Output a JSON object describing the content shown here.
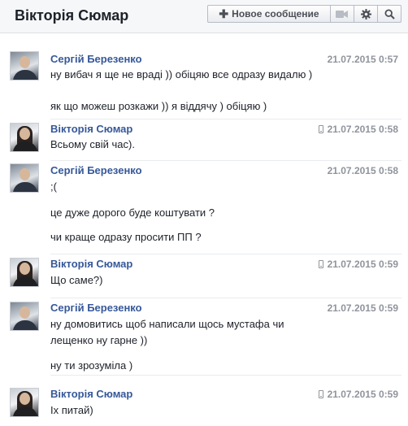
{
  "header": {
    "title": "Вікторія Сюмар",
    "new_message_label": "Новое сообщение",
    "icons": [
      "video-call-icon",
      "gear-icon",
      "search-icon"
    ]
  },
  "messages": [
    {
      "sender": "Сергій Березенко",
      "time": "21.07.2015 0:57",
      "mobile": false,
      "lines": [
        "ну вибач я ще не враді )) обіцяю все одразу видалю )",
        "як що можеш розкажи )) я віддячу ) обіцяю )"
      ]
    },
    {
      "sender": "Вікторія Сюмар",
      "time": "21.07.2015 0:58",
      "mobile": true,
      "lines": [
        "Всьому свій час)."
      ]
    },
    {
      "sender": "Сергій Березенко",
      "time": "21.07.2015 0:58",
      "mobile": false,
      "lines": [
        ";(",
        "це дуже дорого буде коштувати ?",
        "чи краще одразу просити ПП ?"
      ]
    },
    {
      "sender": "Вікторія Сюмар",
      "time": "21.07.2015 0:59",
      "mobile": true,
      "lines": [
        "Що саме?)"
      ]
    },
    {
      "sender": "Сергій Березенко",
      "time": "21.07.2015 0:59",
      "mobile": false,
      "lines": [
        "ну домовитись щоб написали щось мустафа чи",
        "лещенко ну гарне ))",
        "ну ти зрозуміла )"
      ]
    },
    {
      "sender": "Вікторія Сюмар",
      "time": "21.07.2015 0:59",
      "mobile": true,
      "lines": [
        "Іх питай)"
      ]
    }
  ]
}
